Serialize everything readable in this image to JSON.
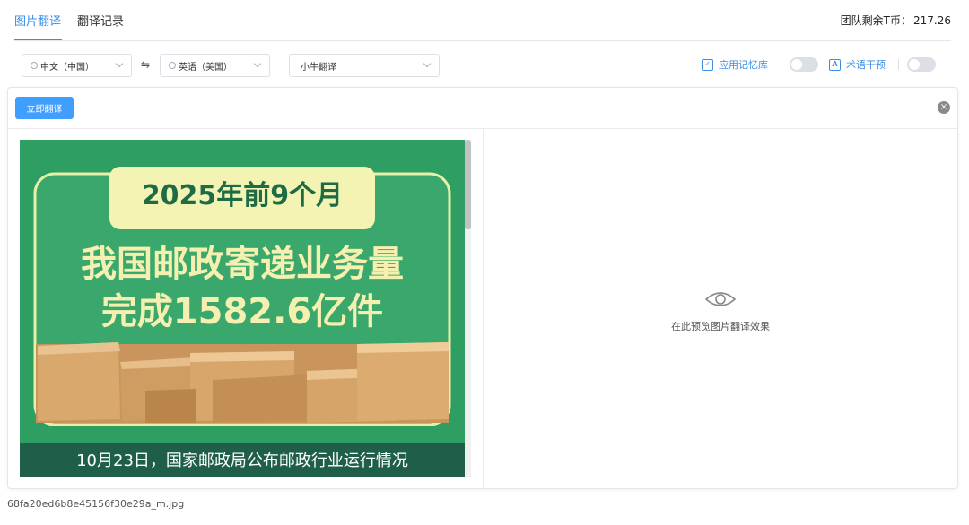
{
  "tabs": [
    {
      "label": "图片翻译",
      "active": true
    },
    {
      "label": "翻译记录",
      "active": false
    }
  ],
  "balance": {
    "label": "团队剩余T币：",
    "value": "217.26"
  },
  "source_lang": "中文（中国）",
  "target_lang": "英语（美国）",
  "engine": "小牛翻译",
  "memory_option": {
    "label": "应用记忆库",
    "enabled": false
  },
  "term_option": {
    "label": "术语干预",
    "enabled": false
  },
  "translate_button": "立即翻译",
  "source_image": {
    "badge": "2025年前9个月",
    "headline_line1": "我国邮政寄递业务量",
    "headline_line2": "完成1582.6亿件",
    "footer": "10月23日，国家邮政局公布邮政行业运行情况"
  },
  "preview_text": "在此预览图片翻译效果",
  "filename": "68fa20ed6b8e45156f30e29a_m.jpg",
  "colors": {
    "accent": "#409eff",
    "image_green": "#2e9e63",
    "image_dark": "#1f5f4a",
    "headline_yellow": "#f5f0b0"
  }
}
